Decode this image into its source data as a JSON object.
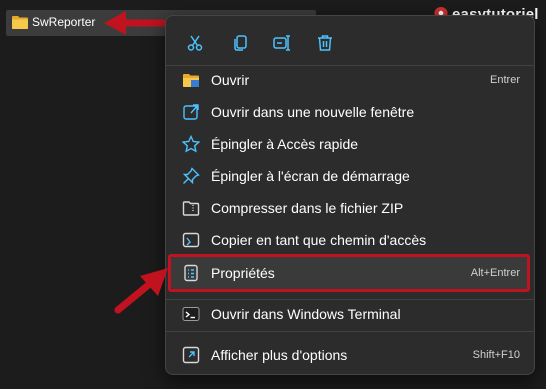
{
  "explorer": {
    "selected_folder": "SwReporter"
  },
  "watermark": {
    "text": "easytutoriel"
  },
  "context_menu": {
    "quick_actions": [
      {
        "icon": "cut-icon"
      },
      {
        "icon": "copy-icon"
      },
      {
        "icon": "rename-icon"
      },
      {
        "icon": "delete-icon"
      }
    ],
    "items": [
      {
        "label": "Ouvrir",
        "shortcut": "Entrer",
        "icon": "folder-open-icon"
      },
      {
        "label": "Ouvrir dans une nouvelle fenêtre",
        "shortcut": "",
        "icon": "new-window-icon"
      },
      {
        "label": "Épingler à Accès rapide",
        "shortcut": "",
        "icon": "star-icon"
      },
      {
        "label": "Épingler à l'écran de démarrage",
        "shortcut": "",
        "icon": "pin-icon"
      },
      {
        "label": "Compresser dans le fichier ZIP",
        "shortcut": "",
        "icon": "zip-icon"
      },
      {
        "label": "Copier en tant que chemin d'accès",
        "shortcut": "",
        "icon": "copy-path-icon"
      },
      {
        "label": "Propriétés",
        "shortcut": "Alt+Entrer",
        "icon": "properties-icon"
      },
      {
        "label": "Ouvrir dans Windows Terminal",
        "shortcut": "",
        "icon": "terminal-icon"
      },
      {
        "label": "Afficher plus d'options",
        "shortcut": "Shift+F10",
        "icon": "more-options-icon"
      }
    ]
  },
  "colors": {
    "accent_blue": "#4cc2ff",
    "highlight_red": "#c1121f",
    "menu_bg": "#2c2c2c"
  }
}
